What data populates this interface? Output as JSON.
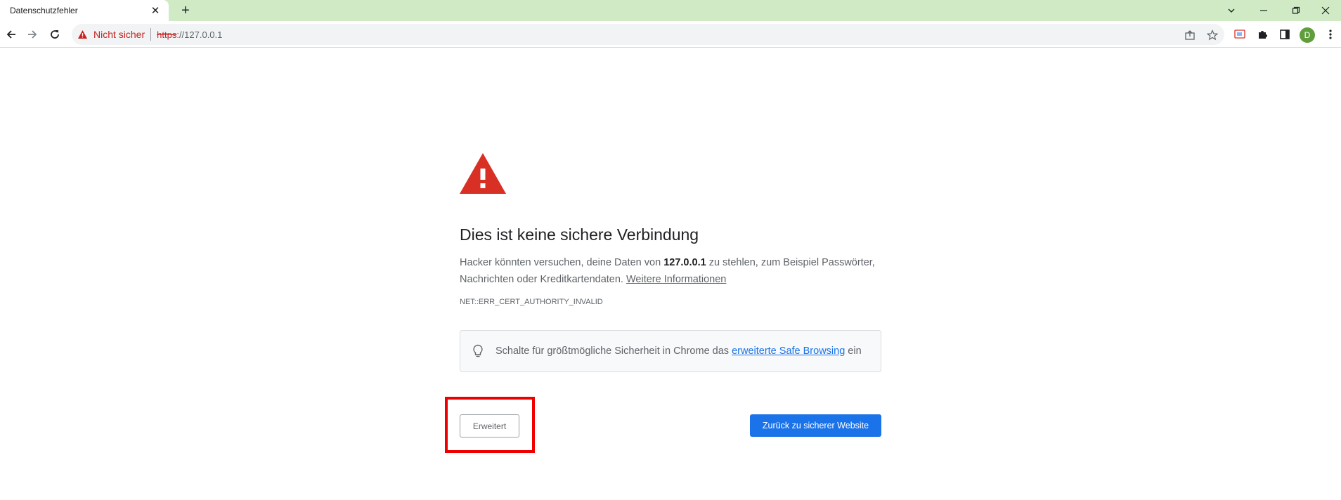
{
  "tab": {
    "title": "Datenschutzfehler",
    "close_glyph": "✕"
  },
  "new_tab_glyph": "+",
  "window_controls": {
    "dropdown": "⌄",
    "minimize": "—",
    "restore": "❐",
    "close": "✕"
  },
  "omnibox": {
    "security_label": "Nicht sicher",
    "url_scheme": "https",
    "url_rest": "://127.0.0.1"
  },
  "profile": {
    "initial": "D",
    "color": "#5f9e3b"
  },
  "interstitial": {
    "heading": "Dies ist keine sichere Verbindung",
    "body_part1": "Hacker könnten versuchen, deine Daten von ",
    "host": "127.0.0.1",
    "body_part2": " zu stehlen, zum Beispiel Passwörter, Nachrichten oder Kreditkartendaten. ",
    "learn_more": "Weitere Informationen",
    "error_code": "NET::ERR_CERT_AUTHORITY_INVALID",
    "safe_part1": "Schalte für größtmögliche Sicherheit in Chrome das ",
    "safe_link": "erweiterte Safe Browsing",
    "safe_part2": " ein",
    "advanced_button": "Erweitert",
    "back_button": "Zurück zu sicherer Website"
  },
  "colors": {
    "tabstrip": "#cfeac5",
    "warning_red": "#d93025",
    "primary_blue": "#1a73e8",
    "highlight_box": "#ee0000"
  }
}
